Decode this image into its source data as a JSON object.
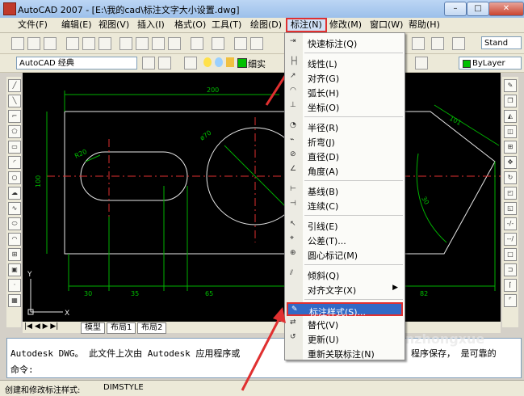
{
  "window": {
    "title": "AutoCAD 2007 - [E:\\我的cad\\标注文字大小设置.dwg]",
    "minimize": "–",
    "maximize": "□",
    "close": "✕"
  },
  "menubar": {
    "items": [
      "文件(F)",
      "编辑(E)",
      "视图(V)",
      "插入(I)",
      "格式(O)",
      "工具(T)",
      "绘图(D)",
      "标注(N)",
      "修改(M)",
      "窗口(W)",
      "帮助(H)"
    ],
    "active_index": 7
  },
  "toolbar": {
    "workspace": "AutoCAD 经典",
    "style_combo": "Stand",
    "layer_label": "细实",
    "color_combo": "ByLayer"
  },
  "drawing": {
    "dims": [
      "200",
      "100",
      "R20",
      "ø70",
      "101",
      "30",
      "30",
      "35",
      "65",
      "82"
    ],
    "axis_y": "Y",
    "axis_x": "X"
  },
  "layout_tabs": [
    "模型",
    "布局1",
    "布局2"
  ],
  "command": {
    "line1": "Autodesk DWG。  此文件上次由 Autodesk 应用程序或",
    "line1_right": "程序保存，  是可靠的",
    "prompt": "命令:"
  },
  "status": {
    "left": "创建和修改标注样式:",
    "cmd": "DIMSTYLE"
  },
  "dropdown": {
    "items": [
      {
        "label": "快速标注(Q)",
        "icon": "quick-dimension-icon"
      },
      {
        "sep": true
      },
      {
        "label": "线性(L)",
        "icon": "linear-icon"
      },
      {
        "label": "对齐(G)",
        "icon": "aligned-icon"
      },
      {
        "label": "弧长(H)",
        "icon": "arc-length-icon"
      },
      {
        "label": "坐标(O)",
        "icon": "ordinate-icon"
      },
      {
        "sep": true
      },
      {
        "label": "半径(R)",
        "icon": "radius-icon"
      },
      {
        "label": "折弯(J)",
        "icon": "jogged-icon"
      },
      {
        "label": "直径(D)",
        "icon": "diameter-icon"
      },
      {
        "label": "角度(A)",
        "icon": "angular-icon"
      },
      {
        "sep": true
      },
      {
        "label": "基线(B)",
        "icon": "baseline-icon"
      },
      {
        "label": "连续(C)",
        "icon": "continue-icon"
      },
      {
        "sep": true
      },
      {
        "label": "引线(E)",
        "icon": "leader-icon"
      },
      {
        "label": "公差(T)...",
        "icon": "tolerance-icon"
      },
      {
        "label": "圆心标记(M)",
        "icon": "center-mark-icon"
      },
      {
        "sep": true
      },
      {
        "label": "倾斜(Q)",
        "icon": "oblique-icon"
      },
      {
        "label": "对齐文字(X)",
        "icon": "",
        "submenu": true
      },
      {
        "sep": true
      },
      {
        "label": "标注样式(S)...",
        "icon": "dimension-style-icon",
        "highlight": true
      },
      {
        "label": "替代(V)",
        "icon": "override-icon"
      },
      {
        "label": "更新(U)",
        "icon": "update-icon"
      },
      {
        "label": "重新关联标注(N)",
        "icon": ""
      }
    ]
  },
  "watermark": "shenzhongxue"
}
